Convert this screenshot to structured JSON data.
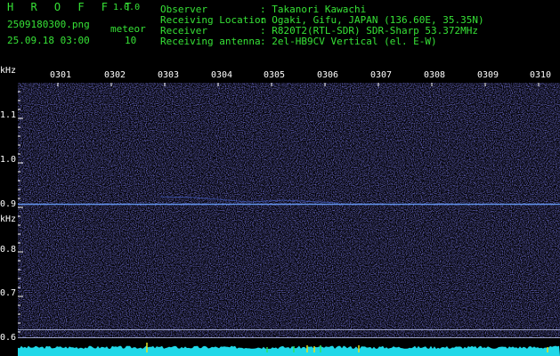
{
  "header": {
    "app_name": "H R O F F T",
    "version": "1.0.0",
    "filename": "2509180300.png",
    "meteor_label": "meteor",
    "timestamp": "25.09.18 03:00",
    "meteor_count": "10"
  },
  "info": [
    {
      "key": "Observer",
      "value": ": Takanori Kawachi"
    },
    {
      "key": "Receiving Location",
      "value": ": Ogaki, Gifu, JAPAN (136.60E, 35.35N)"
    },
    {
      "key": "Receiver",
      "value": ": R820T2(RTL-SDR) SDR-Sharp 53.372MHz"
    },
    {
      "key": "Receiving antenna",
      "value": ": 2el-HB9CV Vertical (el. E-W)"
    }
  ],
  "axis": {
    "unit_top": "kHz",
    "unit_mid": "kHz",
    "time_labels": [
      "0301",
      "0302",
      "0303",
      "0304",
      "0305",
      "0306",
      "0307",
      "0308",
      "0309",
      "0310"
    ],
    "freq_labels": [
      "1.1",
      "1.0",
      "0.9",
      "0.8",
      "0.7",
      "0.6"
    ]
  },
  "colors": {
    "background": "#000000",
    "header_green": "#36e236",
    "noise": "#2a2aa8",
    "carrier": "#6aa0ff",
    "power_trace": "#20d8e8",
    "meteor_spike": "#e8e020"
  }
}
